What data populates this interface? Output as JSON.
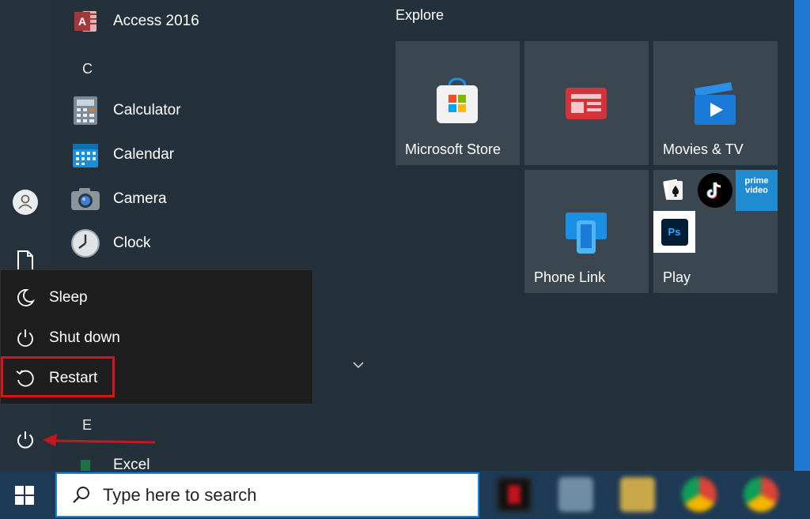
{
  "apps": [
    {
      "name": "Access 2016",
      "icon": "access-icon"
    },
    {
      "name": "Calculator",
      "icon": "calculator-icon"
    },
    {
      "name": "Calendar",
      "icon": "calendar-icon"
    },
    {
      "name": "Camera",
      "icon": "camera-icon"
    },
    {
      "name": "Clock",
      "icon": "clock-icon"
    },
    {
      "name": "Excel",
      "icon": "excel-icon"
    }
  ],
  "letters": {
    "c": "C",
    "e": "E"
  },
  "explore": {
    "title": "Explore",
    "tiles": {
      "store": "Microsoft Store",
      "news": "",
      "movies": "Movies & TV",
      "phone": "Phone Link",
      "play": "Play"
    },
    "play_apps": {
      "prime": "prime video",
      "ps": "Ps"
    }
  },
  "power_menu": {
    "sleep": "Sleep",
    "shutdown": "Shut down",
    "restart": "Restart"
  },
  "taskbar": {
    "search_placeholder": "Type here to search"
  },
  "colors": {
    "start_bg": "#25313a",
    "tile_bg": "#3a4750",
    "menu_bg": "#1e1e1e",
    "highlight": "#d6141c",
    "taskbar": "#1f3a55",
    "accent": "#1a86d6"
  }
}
